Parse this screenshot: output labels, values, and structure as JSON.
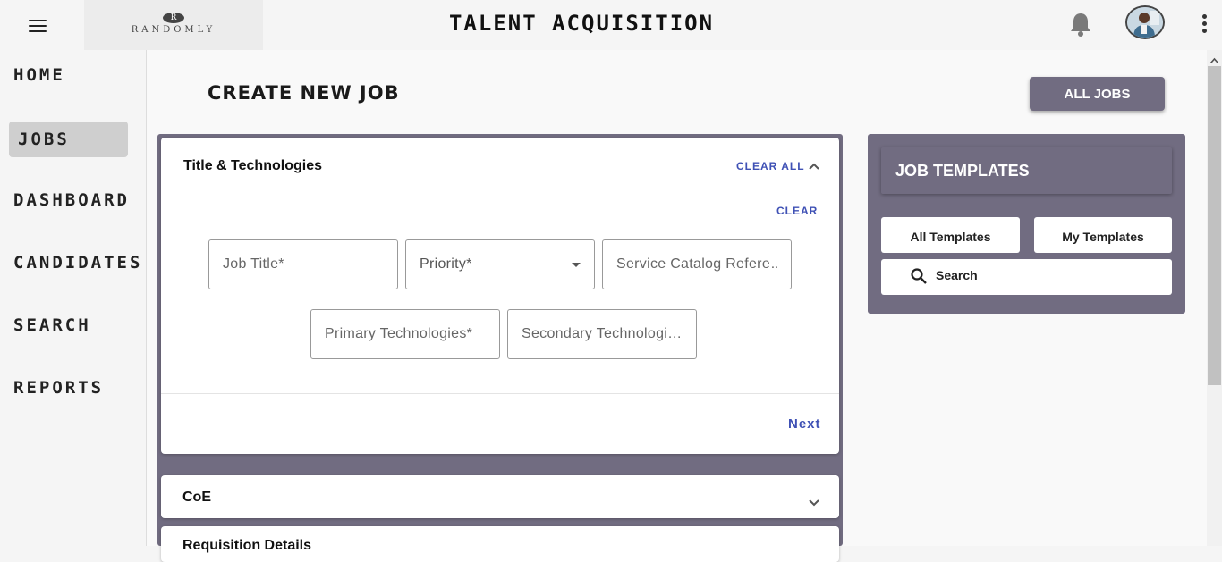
{
  "header": {
    "logo_mark": "R",
    "logo_text": "RANDOMLY",
    "app_title": "TALENT ACQUISITION"
  },
  "sidebar": {
    "items": [
      {
        "label": "HOME",
        "active": false
      },
      {
        "label": "JOBS",
        "active": true
      },
      {
        "label": "DASHBOARD",
        "active": false
      },
      {
        "label": "CANDIDATES",
        "active": false
      },
      {
        "label": "SEARCH",
        "active": false
      },
      {
        "label": "REPORTS",
        "active": false
      }
    ]
  },
  "main": {
    "page_title": "CREATE NEW JOB",
    "all_jobs_label": "ALL JOBS",
    "sections": [
      {
        "title": "Title & Technologies",
        "clear_all_label": "CLEAR ALL",
        "clear_label": "CLEAR",
        "fields": [
          {
            "placeholder": "Job Title*",
            "value": ""
          },
          {
            "placeholder": "Priority*",
            "value": ""
          },
          {
            "placeholder": "Service Catalog Refere…",
            "value": ""
          },
          {
            "placeholder": "Primary Technologies*",
            "value": ""
          },
          {
            "placeholder": "Secondary Technologi…",
            "value": ""
          }
        ],
        "next_label": "Next"
      },
      {
        "title": "CoE"
      },
      {
        "title": "Requisition Details"
      }
    ]
  },
  "templates": {
    "title": "JOB TEMPLATES",
    "all_templates_label": "All Templates",
    "my_templates_label": "My Templates",
    "search_label": "Search"
  },
  "colors": {
    "panel": "#716c81",
    "accent_link": "#3f51b5",
    "active_nav": "#cfcfcf"
  },
  "icons": {
    "menu": "menu-icon",
    "notifications": "bell-icon",
    "more": "kebab-icon",
    "expand": "chevron-up-icon",
    "collapse": "chevron-down-icon",
    "search": "search-icon"
  }
}
